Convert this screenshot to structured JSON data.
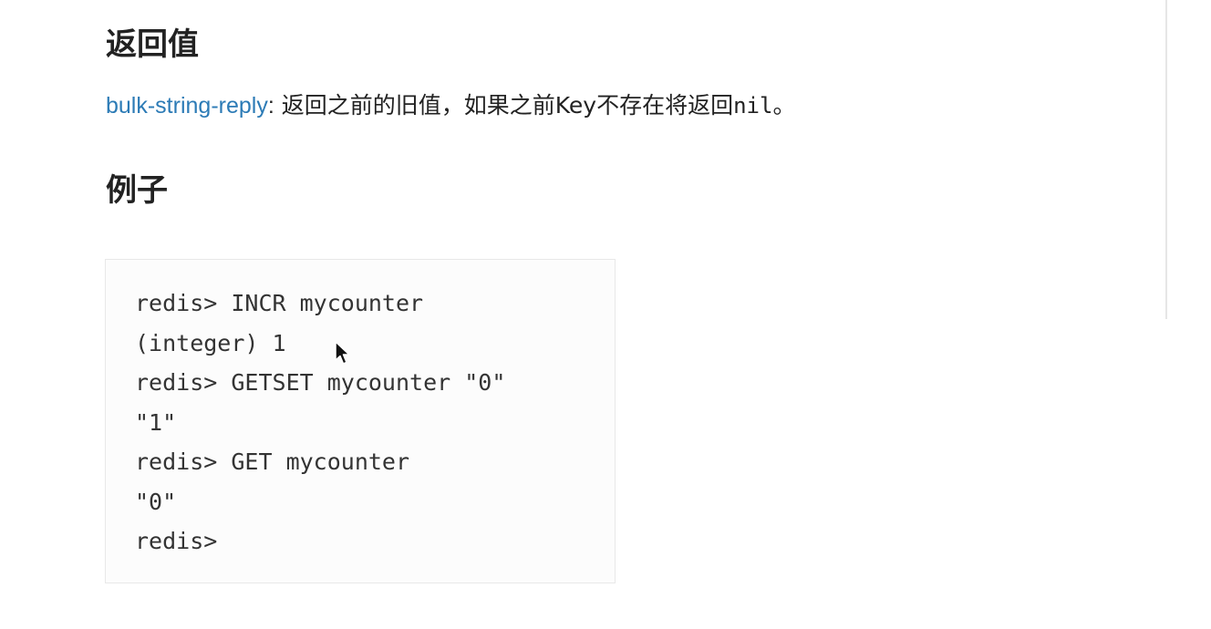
{
  "sections": {
    "return_heading": "返回值",
    "return_link": "bulk-string-reply",
    "return_colon": ":",
    "return_text": " 返回之前的旧值，如果之前Key不存在将返回",
    "return_code": "nil",
    "return_end": "。",
    "example_heading": "例子"
  },
  "code_example": {
    "lines": [
      "redis> INCR mycounter",
      "(integer) 1",
      "redis> GETSET mycounter \"0\"",
      "\"1\"",
      "redis> GET mycounter",
      "\"0\"",
      "redis>"
    ]
  },
  "colors": {
    "link": "#2c7bb6",
    "text": "#222222",
    "code_bg": "#fcfcfc"
  },
  "icons": {
    "cursor": "mouse-pointer-icon"
  }
}
